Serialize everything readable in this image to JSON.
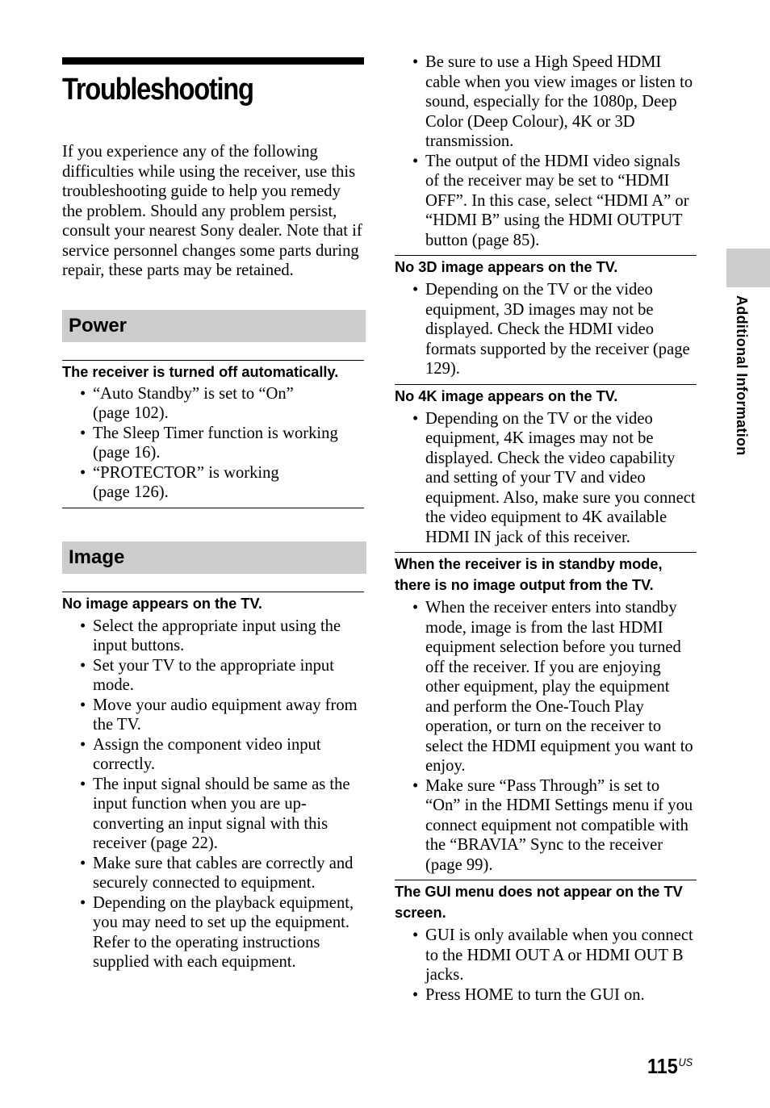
{
  "page": {
    "title": "Troubleshooting",
    "intro": "If you experience any of the following difficulties while using the receiver, use this troubleshooting guide to help you remedy the problem. Should any problem persist, consult your nearest Sony dealer. Note that if service personnel changes some parts during repair, these parts may be retained.",
    "side_tab_label": "Additional Information",
    "page_number": "115",
    "page_suffix": "US"
  },
  "sections": {
    "power": {
      "heading": "Power",
      "items": [
        {
          "question": "The receiver is turned off automatically.",
          "answers": [
            "“Auto Standby” is set to “On” (page 102).",
            "The Sleep Timer function is working (page 16).",
            "“PROTECTOR” is working (page 126)."
          ]
        }
      ]
    },
    "image": {
      "heading": "Image",
      "items": [
        {
          "question": "No image appears on the TV.",
          "answers": [
            "Select the appropriate input using the input buttons.",
            "Set your TV to the appropriate input mode.",
            "Move your audio equipment away from the TV.",
            "Assign the component video input correctly.",
            "The input signal should be same as the input function when you are up-converting an input signal with this receiver (page 22).",
            "Make sure that cables are correctly and securely connected to equipment.",
            "Depending on the playback equipment, you may need to set up the equipment. Refer to the operating instructions supplied with each equipment.",
            "Be sure to use a High Speed HDMI cable when you view images or listen to sound, especially for the 1080p, Deep Color (Deep Colour), 4K or 3D transmission.",
            "The output of the HDMI video signals of the receiver may be set to “HDMI OFF”. In this case, select “HDMI A” or “HDMI B” using the HDMI OUTPUT button (page 85)."
          ]
        },
        {
          "question": "No 3D image appears on the TV.",
          "answers": [
            "Depending on the TV or the video equipment, 3D images may not be displayed. Check the HDMI video formats supported by the receiver (page 129)."
          ]
        },
        {
          "question": "No 4K image appears on the TV.",
          "answers": [
            "Depending on the TV or the video equipment, 4K images may not be displayed. Check the video capability and setting of your TV and video equipment. Also, make sure you connect the video equipment to 4K available HDMI IN jack of this receiver."
          ]
        },
        {
          "question": "When the receiver is in standby mode, there is no image output from the TV.",
          "answers": [
            "When the receiver enters into standby mode, image is from the last HDMI equipment selection before you turned off the receiver. If you are enjoying other equipment, play the equipment and perform the One-Touch Play operation, or turn on the receiver to select the HDMI equipment you want to enjoy.",
            "Make sure “Pass Through” is set to “On” in the HDMI Settings menu if you connect equipment not compatible with the “BRAVIA” Sync to the receiver (page 99)."
          ]
        },
        {
          "question": "The GUI menu does not appear on the TV screen.",
          "answers": [
            "GUI is only available when you connect to the HDMI OUT A or HDMI OUT B jacks.",
            "Press HOME to turn the GUI on."
          ]
        }
      ]
    }
  }
}
